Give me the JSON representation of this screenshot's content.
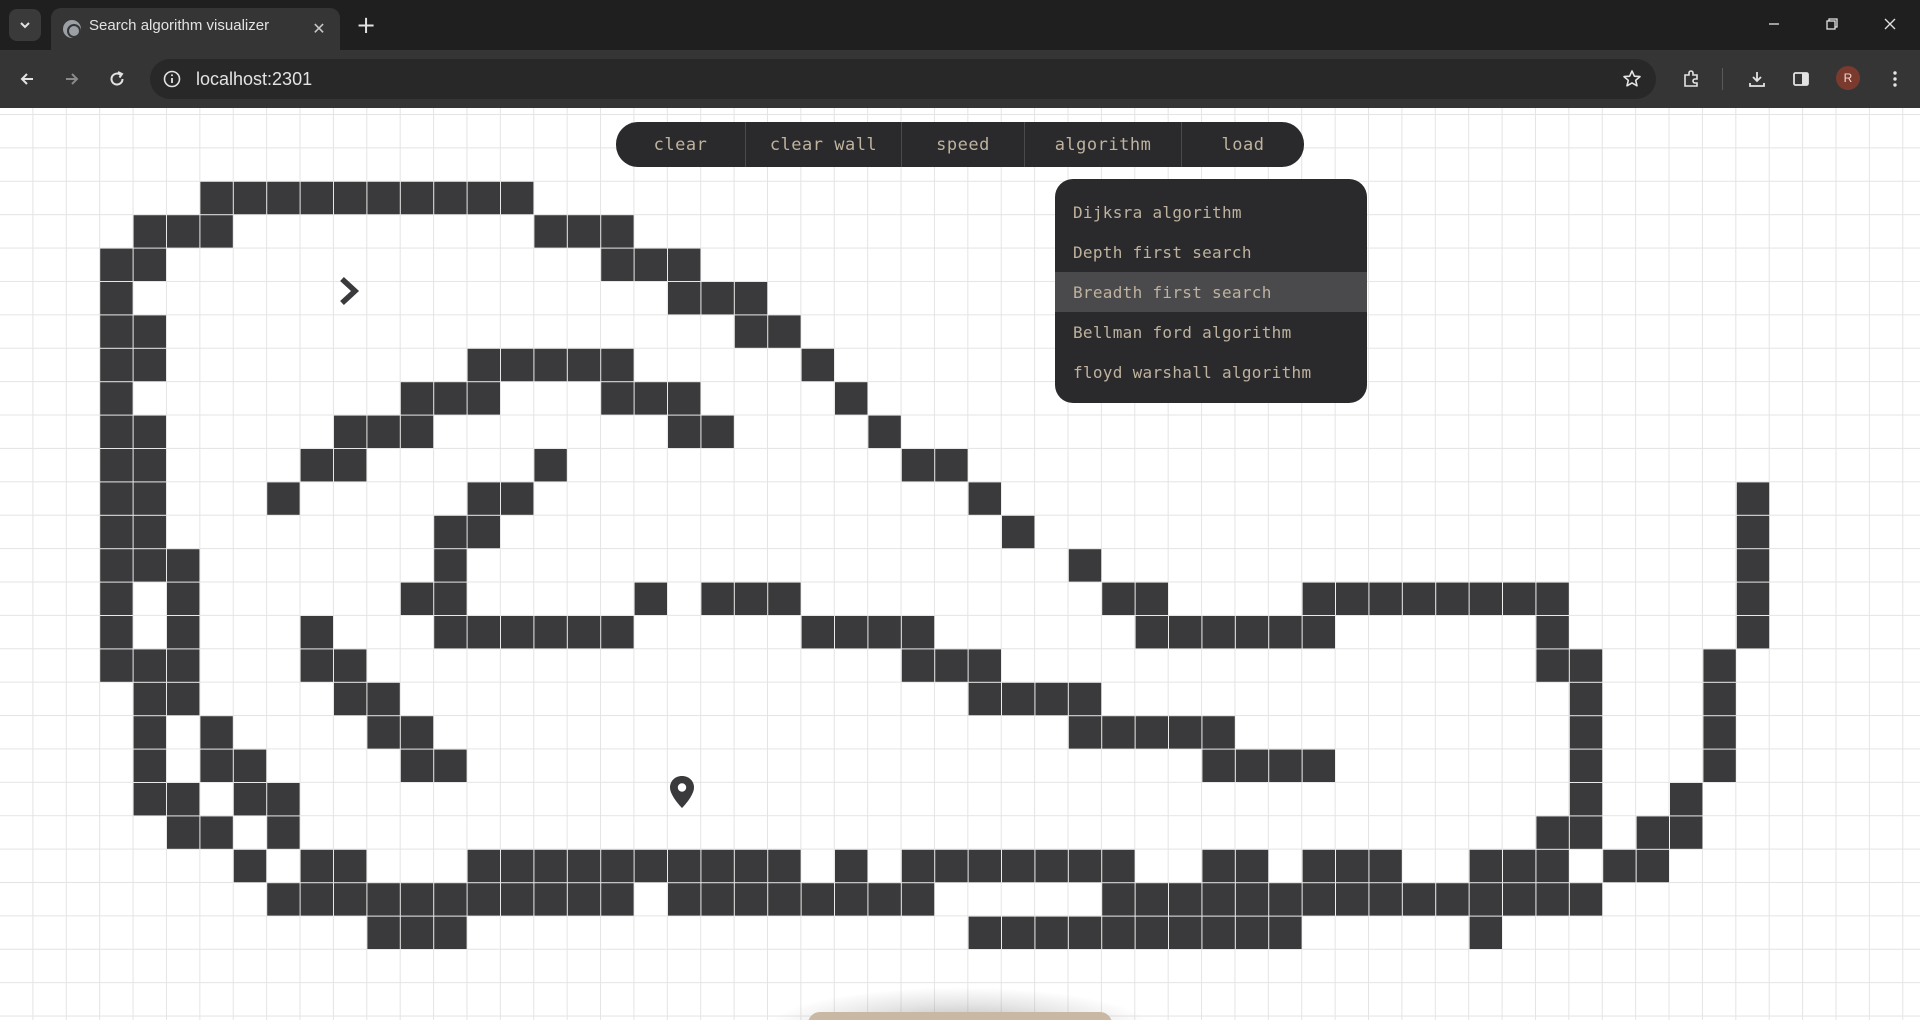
{
  "browser": {
    "tab_title": "Search algorithm visualizer",
    "url": "localhost:2301",
    "profile_initial": "R"
  },
  "app": {
    "menu": [
      {
        "label": "clear",
        "name": "clear-button"
      },
      {
        "label": "clear wall",
        "name": "clear-wall-button"
      },
      {
        "label": "speed",
        "name": "speed-button"
      },
      {
        "label": "algorithm",
        "name": "algorithm-button"
      },
      {
        "label": "load",
        "name": "load-button"
      }
    ],
    "algorithm_dropdown": {
      "items": [
        "Dijksra algorithm",
        "Depth first search",
        "Breadth first search",
        "Bellman ford algorithm",
        "floyd warshall algorithm"
      ],
      "highlighted_index": 2
    },
    "colors": {
      "wall": "#3a3a3c",
      "menu_bg": "#2a2a2c",
      "menu_text": "#bfb29e",
      "grid_line": "#e4e4e4"
    },
    "icons": {
      "start": "chevron-right-icon",
      "target": "map-pin-icon"
    },
    "grid": {
      "cols": 58,
      "rows": 28,
      "walls": [
        [
          6,
          2
        ],
        [
          7,
          2
        ],
        [
          8,
          2
        ],
        [
          9,
          2
        ],
        [
          10,
          2
        ],
        [
          11,
          2
        ],
        [
          12,
          2
        ],
        [
          13,
          2
        ],
        [
          14,
          2
        ],
        [
          15,
          2
        ],
        [
          4,
          3
        ],
        [
          5,
          3
        ],
        [
          6,
          3
        ],
        [
          16,
          3
        ],
        [
          17,
          3
        ],
        [
          18,
          3
        ],
        [
          3,
          4
        ],
        [
          4,
          4
        ],
        [
          18,
          4
        ],
        [
          19,
          4
        ],
        [
          20,
          4
        ],
        [
          3,
          5
        ],
        [
          20,
          5
        ],
        [
          21,
          5
        ],
        [
          22,
          5
        ],
        [
          3,
          6
        ],
        [
          4,
          6
        ],
        [
          22,
          6
        ],
        [
          23,
          6
        ],
        [
          3,
          7
        ],
        [
          4,
          7
        ],
        [
          14,
          7
        ],
        [
          15,
          7
        ],
        [
          16,
          7
        ],
        [
          17,
          7
        ],
        [
          18,
          7
        ],
        [
          24,
          7
        ],
        [
          3,
          8
        ],
        [
          12,
          8
        ],
        [
          13,
          8
        ],
        [
          14,
          8
        ],
        [
          18,
          8
        ],
        [
          19,
          8
        ],
        [
          20,
          8
        ],
        [
          25,
          8
        ],
        [
          3,
          9
        ],
        [
          4,
          9
        ],
        [
          10,
          9
        ],
        [
          11,
          9
        ],
        [
          12,
          9
        ],
        [
          20,
          9
        ],
        [
          21,
          9
        ],
        [
          26,
          9
        ],
        [
          3,
          10
        ],
        [
          4,
          10
        ],
        [
          9,
          10
        ],
        [
          10,
          10
        ],
        [
          16,
          10
        ],
        [
          27,
          10
        ],
        [
          28,
          10
        ],
        [
          3,
          11
        ],
        [
          4,
          11
        ],
        [
          8,
          11
        ],
        [
          14,
          11
        ],
        [
          15,
          11
        ],
        [
          29,
          11
        ],
        [
          52,
          11
        ],
        [
          3,
          12
        ],
        [
          4,
          12
        ],
        [
          13,
          12
        ],
        [
          14,
          12
        ],
        [
          30,
          12
        ],
        [
          52,
          12
        ],
        [
          3,
          13
        ],
        [
          4,
          13
        ],
        [
          5,
          13
        ],
        [
          13,
          13
        ],
        [
          32,
          13
        ],
        [
          52,
          13
        ],
        [
          3,
          14
        ],
        [
          5,
          14
        ],
        [
          12,
          14
        ],
        [
          13,
          14
        ],
        [
          19,
          14
        ],
        [
          21,
          14
        ],
        [
          22,
          14
        ],
        [
          23,
          14
        ],
        [
          33,
          14
        ],
        [
          34,
          14
        ],
        [
          39,
          14
        ],
        [
          40,
          14
        ],
        [
          41,
          14
        ],
        [
          42,
          14
        ],
        [
          43,
          14
        ],
        [
          44,
          14
        ],
        [
          45,
          14
        ],
        [
          46,
          14
        ],
        [
          52,
          14
        ],
        [
          3,
          15
        ],
        [
          5,
          15
        ],
        [
          9,
          15
        ],
        [
          13,
          15
        ],
        [
          14,
          15
        ],
        [
          15,
          15
        ],
        [
          16,
          15
        ],
        [
          17,
          15
        ],
        [
          18,
          15
        ],
        [
          24,
          15
        ],
        [
          25,
          15
        ],
        [
          26,
          15
        ],
        [
          27,
          15
        ],
        [
          34,
          15
        ],
        [
          35,
          15
        ],
        [
          36,
          15
        ],
        [
          37,
          15
        ],
        [
          38,
          15
        ],
        [
          39,
          15
        ],
        [
          46,
          15
        ],
        [
          52,
          15
        ],
        [
          3,
          16
        ],
        [
          4,
          16
        ],
        [
          5,
          16
        ],
        [
          9,
          16
        ],
        [
          10,
          16
        ],
        [
          27,
          16
        ],
        [
          28,
          16
        ],
        [
          29,
          16
        ],
        [
          46,
          16
        ],
        [
          47,
          16
        ],
        [
          51,
          16
        ],
        [
          4,
          17
        ],
        [
          5,
          17
        ],
        [
          10,
          17
        ],
        [
          11,
          17
        ],
        [
          29,
          17
        ],
        [
          30,
          17
        ],
        [
          31,
          17
        ],
        [
          32,
          17
        ],
        [
          47,
          17
        ],
        [
          51,
          17
        ],
        [
          4,
          18
        ],
        [
          6,
          18
        ],
        [
          11,
          18
        ],
        [
          12,
          18
        ],
        [
          32,
          18
        ],
        [
          33,
          18
        ],
        [
          34,
          18
        ],
        [
          35,
          18
        ],
        [
          36,
          18
        ],
        [
          47,
          18
        ],
        [
          51,
          18
        ],
        [
          4,
          19
        ],
        [
          6,
          19
        ],
        [
          7,
          19
        ],
        [
          12,
          19
        ],
        [
          13,
          19
        ],
        [
          36,
          19
        ],
        [
          37,
          19
        ],
        [
          38,
          19
        ],
        [
          39,
          19
        ],
        [
          47,
          19
        ],
        [
          51,
          19
        ],
        [
          4,
          20
        ],
        [
          5,
          20
        ],
        [
          7,
          20
        ],
        [
          8,
          20
        ],
        [
          47,
          20
        ],
        [
          50,
          20
        ],
        [
          5,
          21
        ],
        [
          6,
          21
        ],
        [
          8,
          21
        ],
        [
          46,
          21
        ],
        [
          47,
          21
        ],
        [
          49,
          21
        ],
        [
          50,
          21
        ],
        [
          7,
          22
        ],
        [
          9,
          22
        ],
        [
          10,
          22
        ],
        [
          14,
          22
        ],
        [
          15,
          22
        ],
        [
          16,
          22
        ],
        [
          17,
          22
        ],
        [
          18,
          22
        ],
        [
          19,
          22
        ],
        [
          20,
          22
        ],
        [
          21,
          22
        ],
        [
          22,
          22
        ],
        [
          23,
          22
        ],
        [
          25,
          22
        ],
        [
          27,
          22
        ],
        [
          28,
          22
        ],
        [
          29,
          22
        ],
        [
          30,
          22
        ],
        [
          31,
          22
        ],
        [
          32,
          22
        ],
        [
          33,
          22
        ],
        [
          36,
          22
        ],
        [
          37,
          22
        ],
        [
          39,
          22
        ],
        [
          40,
          22
        ],
        [
          41,
          22
        ],
        [
          44,
          22
        ],
        [
          45,
          22
        ],
        [
          46,
          22
        ],
        [
          48,
          22
        ],
        [
          49,
          22
        ],
        [
          8,
          23
        ],
        [
          9,
          23
        ],
        [
          10,
          23
        ],
        [
          11,
          23
        ],
        [
          12,
          23
        ],
        [
          13,
          23
        ],
        [
          14,
          23
        ],
        [
          15,
          23
        ],
        [
          16,
          23
        ],
        [
          17,
          23
        ],
        [
          18,
          23
        ],
        [
          20,
          23
        ],
        [
          21,
          23
        ],
        [
          22,
          23
        ],
        [
          23,
          23
        ],
        [
          24,
          23
        ],
        [
          25,
          23
        ],
        [
          26,
          23
        ],
        [
          27,
          23
        ],
        [
          33,
          23
        ],
        [
          34,
          23
        ],
        [
          35,
          23
        ],
        [
          36,
          23
        ],
        [
          37,
          23
        ],
        [
          38,
          23
        ],
        [
          39,
          23
        ],
        [
          40,
          23
        ],
        [
          41,
          23
        ],
        [
          42,
          23
        ],
        [
          43,
          23
        ],
        [
          44,
          23
        ],
        [
          45,
          23
        ],
        [
          46,
          23
        ],
        [
          47,
          23
        ],
        [
          11,
          24
        ],
        [
          12,
          24
        ],
        [
          13,
          24
        ],
        [
          29,
          24
        ],
        [
          30,
          24
        ],
        [
          31,
          24
        ],
        [
          32,
          24
        ],
        [
          33,
          24
        ],
        [
          34,
          24
        ],
        [
          35,
          24
        ],
        [
          36,
          24
        ],
        [
          37,
          24
        ],
        [
          38,
          24
        ],
        [
          44,
          24
        ]
      ]
    }
  }
}
